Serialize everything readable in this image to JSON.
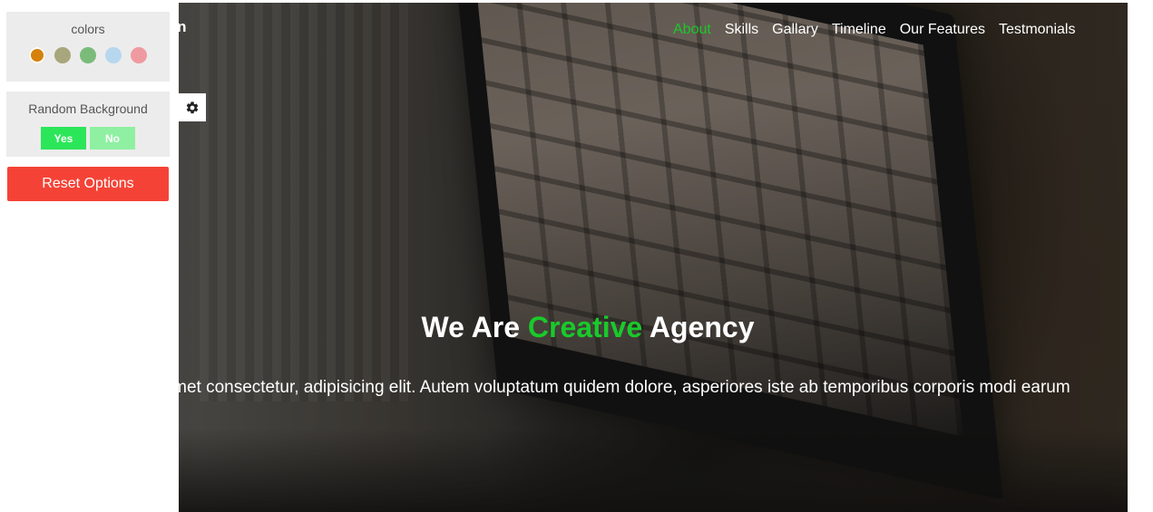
{
  "header": {
    "logo_text": "ign",
    "nav": [
      {
        "label": "About",
        "active": true
      },
      {
        "label": "Skills",
        "active": false
      },
      {
        "label": "Gallary",
        "active": false
      },
      {
        "label": "Timeline",
        "active": false
      },
      {
        "label": "Our Features",
        "active": false
      },
      {
        "label": "Testmonials",
        "active": false
      }
    ]
  },
  "hero": {
    "title_pre": "We Are",
    "title_accent": "Creative",
    "title_post": "Agency",
    "description": "olor sit amet consectetur, adipisicing elit. Autem voluptatum quidem dolore, asperiores iste ab temporibus corporis modi earum"
  },
  "settings": {
    "colors_title": "colors",
    "swatches": [
      "#d4820b",
      "#a8a67c",
      "#7bbb7a",
      "#b7d7ee",
      "#ef9aa0"
    ],
    "active_swatch_index": 0,
    "random_bg_title": "Random Background",
    "yes_label": "Yes",
    "no_label": "No",
    "reset_label": "Reset Options",
    "gear_icon": "gear-icon"
  },
  "colors": {
    "accent": "#19c92a",
    "reset": "#f44336",
    "yes": "#2ce65a",
    "no": "#8ff0a2"
  }
}
